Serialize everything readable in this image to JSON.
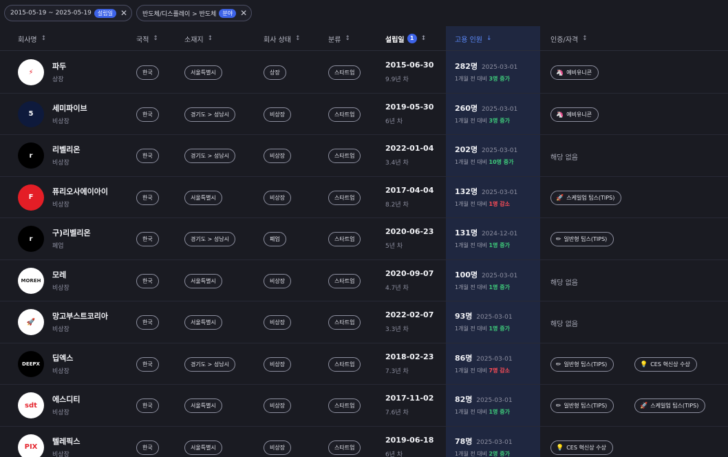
{
  "filters": [
    {
      "text": "2015-05-19 ~ 2025-05-19",
      "badge": "설립일",
      "close": "✕"
    },
    {
      "text": "반도체/디스플레이 > 반도체",
      "badge": "분야",
      "close": "✕"
    }
  ],
  "headers": {
    "company": "회사명",
    "country": "국적",
    "location": "소재지",
    "status": "회사 상태",
    "category": "분류",
    "founded": "설립일",
    "founded_badge": "1",
    "employees": "고용 인원",
    "certs": "인증/자격",
    "sort_icon": "↕",
    "sort_down": "↓"
  },
  "rows": [
    {
      "name": "파두",
      "status": "상장",
      "country": "한국",
      "location": "서울특별시",
      "company_status": "상장",
      "category": "스타트업",
      "founded": "2015-06-30",
      "age": "9.9년 차",
      "emp": "282명",
      "emp_date": "2025-03-01",
      "change_prefix": "1개월 전 대비",
      "change": "3명 증가",
      "dir": "up",
      "logo": {
        "text": "⚡",
        "bg": "#ffffff",
        "fg": "#e8212e"
      },
      "certs": [
        {
          "icon": "🦄",
          "label": "예비유니콘"
        }
      ]
    },
    {
      "name": "세미파이브",
      "status": "비상장",
      "country": "한국",
      "location": "경기도 > 성남시",
      "company_status": "비상장",
      "category": "스타트업",
      "founded": "2019-05-30",
      "age": "6년 차",
      "emp": "260명",
      "emp_date": "2025-03-01",
      "change_prefix": "1개월 전 대비",
      "change": "3명 증가",
      "dir": "up",
      "logo": {
        "text": "5",
        "bg": "#0e1a3c",
        "fg": "#ffffff"
      },
      "certs": [
        {
          "icon": "🦄",
          "label": "예비유니콘"
        }
      ]
    },
    {
      "name": "리벨리온",
      "status": "비상장",
      "country": "한국",
      "location": "경기도 > 성남시",
      "company_status": "비상장",
      "category": "스타트업",
      "founded": "2022-01-04",
      "age": "3.4년 차",
      "emp": "202명",
      "emp_date": "2025-03-01",
      "change_prefix": "1개월 전 대비",
      "change": "10명 증가",
      "dir": "up",
      "logo": {
        "text": "r",
        "bg": "#000000",
        "fg": "#ffffff"
      },
      "certs": [],
      "no_cert": "해당 없음"
    },
    {
      "name": "퓨리오사에이아이",
      "status": "비상장",
      "country": "한국",
      "location": "서울특별시",
      "company_status": "비상장",
      "category": "스타트업",
      "founded": "2017-04-04",
      "age": "8.2년 차",
      "emp": "132명",
      "emp_date": "2025-03-01",
      "change_prefix": "1개월 전 대비",
      "change": "1명 감소",
      "dir": "down",
      "logo": {
        "text": "F",
        "bg": "#e41e26",
        "fg": "#ffffff"
      },
      "certs": [
        {
          "icon": "🚀",
          "label": "스케일업 팁스(TIPS)"
        }
      ]
    },
    {
      "name": "구)리벨리온",
      "status": "폐업",
      "country": "한국",
      "location": "경기도 > 성남시",
      "company_status": "폐업",
      "category": "스타트업",
      "founded": "2020-06-23",
      "age": "5년 차",
      "emp": "131명",
      "emp_date": "2024-12-01",
      "change_prefix": "1개월 전 대비",
      "change": "1명 증가",
      "dir": "up",
      "logo": {
        "text": "r",
        "bg": "#000000",
        "fg": "#ffffff"
      },
      "certs": [
        {
          "icon": "✏",
          "label": "일반형 팁스(TIPS)"
        }
      ]
    },
    {
      "name": "모레",
      "status": "비상장",
      "country": "한국",
      "location": "서울특별시",
      "company_status": "비상장",
      "category": "스타트업",
      "founded": "2020-09-07",
      "age": "4.7년 차",
      "emp": "100명",
      "emp_date": "2025-03-01",
      "change_prefix": "1개월 전 대비",
      "change": "1명 증가",
      "dir": "up",
      "logo": {
        "text": "MOREH",
        "bg": "#ffffff",
        "fg": "#222222"
      },
      "certs": [],
      "no_cert": "해당 없음"
    },
    {
      "name": "망고부스트코리아",
      "status": "비상장",
      "country": "한국",
      "location": "서울특별시",
      "company_status": "비상장",
      "category": "스타트업",
      "founded": "2022-02-07",
      "age": "3.3년 차",
      "emp": "93명",
      "emp_date": "2025-03-01",
      "change_prefix": "1개월 전 대비",
      "change": "1명 증가",
      "dir": "up",
      "logo": {
        "text": "🚀",
        "bg": "#ffffff",
        "fg": "#f08a24"
      },
      "certs": [],
      "no_cert": "해당 없음"
    },
    {
      "name": "딥엑스",
      "status": "비상장",
      "country": "한국",
      "location": "경기도 > 성남시",
      "company_status": "비상장",
      "category": "스타트업",
      "founded": "2018-02-23",
      "age": "7.3년 차",
      "emp": "86명",
      "emp_date": "2025-03-01",
      "change_prefix": "1개월 전 대비",
      "change": "7명 감소",
      "dir": "down",
      "logo": {
        "text": "DEEPX",
        "bg": "#000000",
        "fg": "#ffffff"
      },
      "certs": [
        {
          "icon": "✏",
          "label": "일반형 팁스(TIPS)"
        },
        {
          "icon": "💡",
          "label": "CES 혁신상 수상"
        }
      ]
    },
    {
      "name": "에스디티",
      "status": "비상장",
      "country": "한국",
      "location": "서울특별시",
      "company_status": "비상장",
      "category": "스타트업",
      "founded": "2017-11-02",
      "age": "7.6년 차",
      "emp": "82명",
      "emp_date": "2025-03-01",
      "change_prefix": "1개월 전 대비",
      "change": "1명 증가",
      "dir": "up",
      "logo": {
        "text": "sdt",
        "bg": "#ffffff",
        "fg": "#e5262f"
      },
      "certs": [
        {
          "icon": "✏",
          "label": "일반형 팁스(TIPS)"
        },
        {
          "icon": "🚀",
          "label": "스케일업 팁스(TIPS)"
        }
      ]
    },
    {
      "name": "텔레픽스",
      "status": "비상장",
      "country": "한국",
      "location": "서울특별시",
      "company_status": "비상장",
      "category": "스타트업",
      "founded": "2019-06-18",
      "age": "6년 차",
      "emp": "78명",
      "emp_date": "2025-03-01",
      "change_prefix": "1개월 전 대비",
      "change": "2명 증가",
      "dir": "up",
      "logo": {
        "text": "PIX",
        "bg": "#ffffff",
        "fg": "#e5262f"
      },
      "certs": [
        {
          "icon": "💡",
          "label": "CES 혁신상 수상"
        }
      ]
    }
  ]
}
